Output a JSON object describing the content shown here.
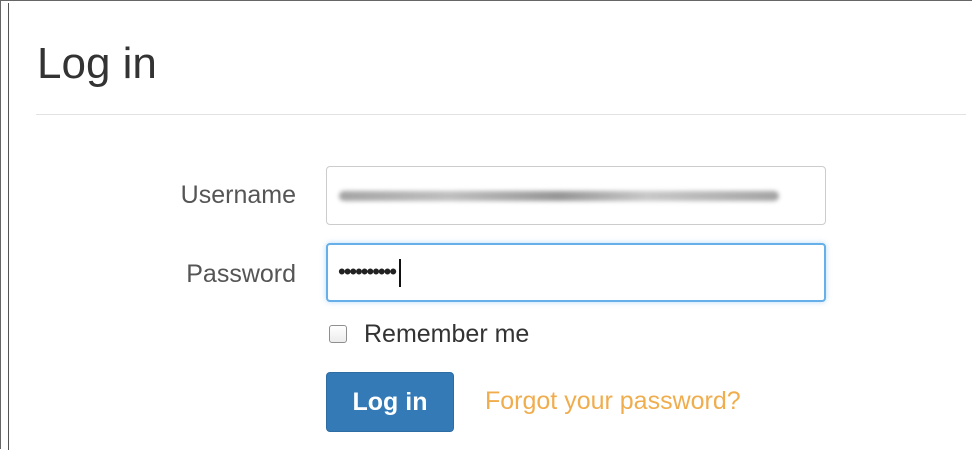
{
  "page": {
    "title": "Log in"
  },
  "form": {
    "username_label": "Username",
    "password_label": "Password",
    "password_value": "••••••••••",
    "remember_label": "Remember me",
    "remember_checked": false,
    "login_button_label": "Log in",
    "forgot_link_label": "Forgot your password?"
  },
  "colors": {
    "primary": "#337ab7",
    "link": "#f0ad4e",
    "focus_border": "#66afe9"
  }
}
